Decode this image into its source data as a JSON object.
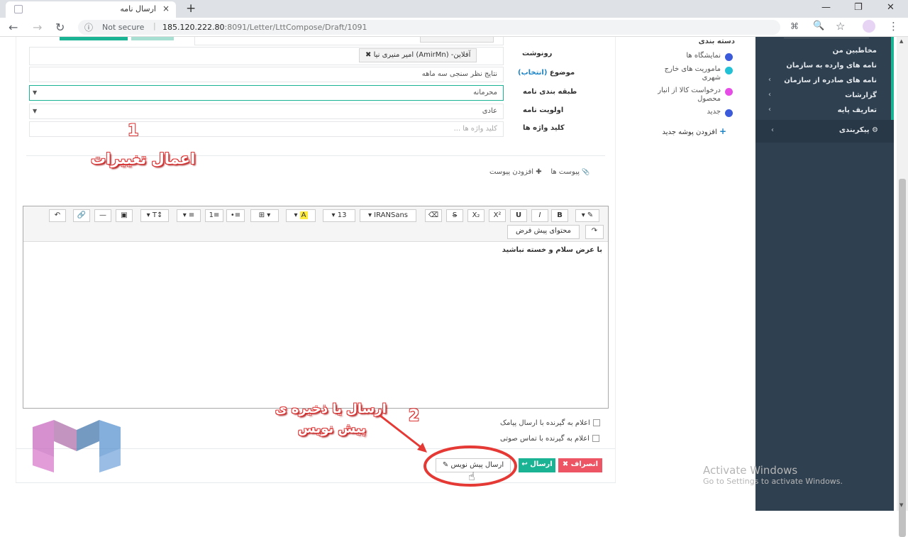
{
  "browser": {
    "tab_title": "ارسال نامه",
    "tab_close": "×",
    "new_tab": "+",
    "security": "Not secure",
    "url_host": "185.120.222.80",
    "url_rest": ":8091/Letter/LttCompose/Draft/1091",
    "back": "←",
    "forward": "→",
    "reload": "↻",
    "info_icon": "ⓘ",
    "zoom_icon": "🔍",
    "star_icon": "☆",
    "menu_icon": "⋮",
    "minimize": "—",
    "maximize": "❐",
    "close": "✕"
  },
  "sidebar": {
    "items": [
      {
        "label": "مخاطبین من",
        "chevron": ""
      },
      {
        "label": "نامه های وارده به سازمان",
        "chevron": ""
      },
      {
        "label": "نامه های صادره از سازمان",
        "chevron": "‹"
      },
      {
        "label": "گزارشات",
        "chevron": "‹"
      },
      {
        "label": "تعاریف پایه",
        "chevron": "‹"
      }
    ],
    "config_label": "پیکربندی",
    "config_icon": "⚙",
    "config_chevron": "‹",
    "accent_color": "#1ab394",
    "bg_color": "#2f4050"
  },
  "folders": {
    "header": "دسته بندی",
    "items": [
      {
        "label": "نمایشگاه ها",
        "color": "#3b5bdb"
      },
      {
        "label": "ماموریت های خارج شهری",
        "color": "#22c1d6"
      },
      {
        "label": "درخواست کالا از انبار محصول",
        "color": "#e64de6"
      },
      {
        "label": "جدید",
        "color": "#3b5bdb"
      }
    ],
    "add_label": "افزودن پوشه جدید",
    "add_icon": "+"
  },
  "form": {
    "cc_label": "رونوشت",
    "cc_chip": "امیر منیری نیا (AmirMn) -آفلاین",
    "cc_chip_remove": "✖",
    "subject_label": "موضوع",
    "subject_select": "(انتخاب)",
    "subject_value": "نتایج نظر سنجی سه ماهه",
    "class_label": "طبقه بندی نامه",
    "class_value": "محرمانه",
    "priority_label": "اولویت نامه",
    "priority_value": "عادی",
    "keywords_label": "کلید واژه ها",
    "keywords_placeholder": "کلید واژه ها ...",
    "dropdown_caret": "▼"
  },
  "attachments": {
    "label": "پیوست ها",
    "add_label": "افزودن پیوست",
    "clip_icon": "📎",
    "plus_icon": "✚"
  },
  "editor": {
    "toolbar_row1": [
      "↶",
      "🔗",
      "—",
      "▣",
      "T↕",
      "≡",
      "1≡",
      "•≡",
      "⊞",
      "A",
      "13",
      "IRANSans",
      "⌫",
      "S",
      "X₂",
      "X²",
      "U",
      "I",
      "B",
      "✎"
    ],
    "default_content_btn": "محتوای پیش فرض",
    "redo": "↷",
    "body_text": "با عرض سلام و خسته نباشید",
    "font_size": "13",
    "font_name": "IRANSans"
  },
  "options": {
    "sms": "اعلام به گیرنده با ارسال پیامک",
    "voice": "اعلام به گیرنده با تماس صوتی"
  },
  "actions": {
    "draft": "ارسال پیش نویس",
    "draft_icon": "✎",
    "send": "ارسال",
    "send_icon": "↩",
    "cancel": "انصراف",
    "cancel_icon": "✖",
    "send_color": "#1ab394",
    "cancel_color": "#ed5565"
  },
  "annotations": {
    "num1": "1",
    "text1": "اعمال تغییرات",
    "num2": "2",
    "text2_line1": "ارسال یا ذخیره ی",
    "text2_line2": "پیش نویس",
    "highlight_color": "#e53935"
  },
  "watermark": {
    "line1": "Activate Windows",
    "line2": "Go to Settings to activate Windows."
  }
}
